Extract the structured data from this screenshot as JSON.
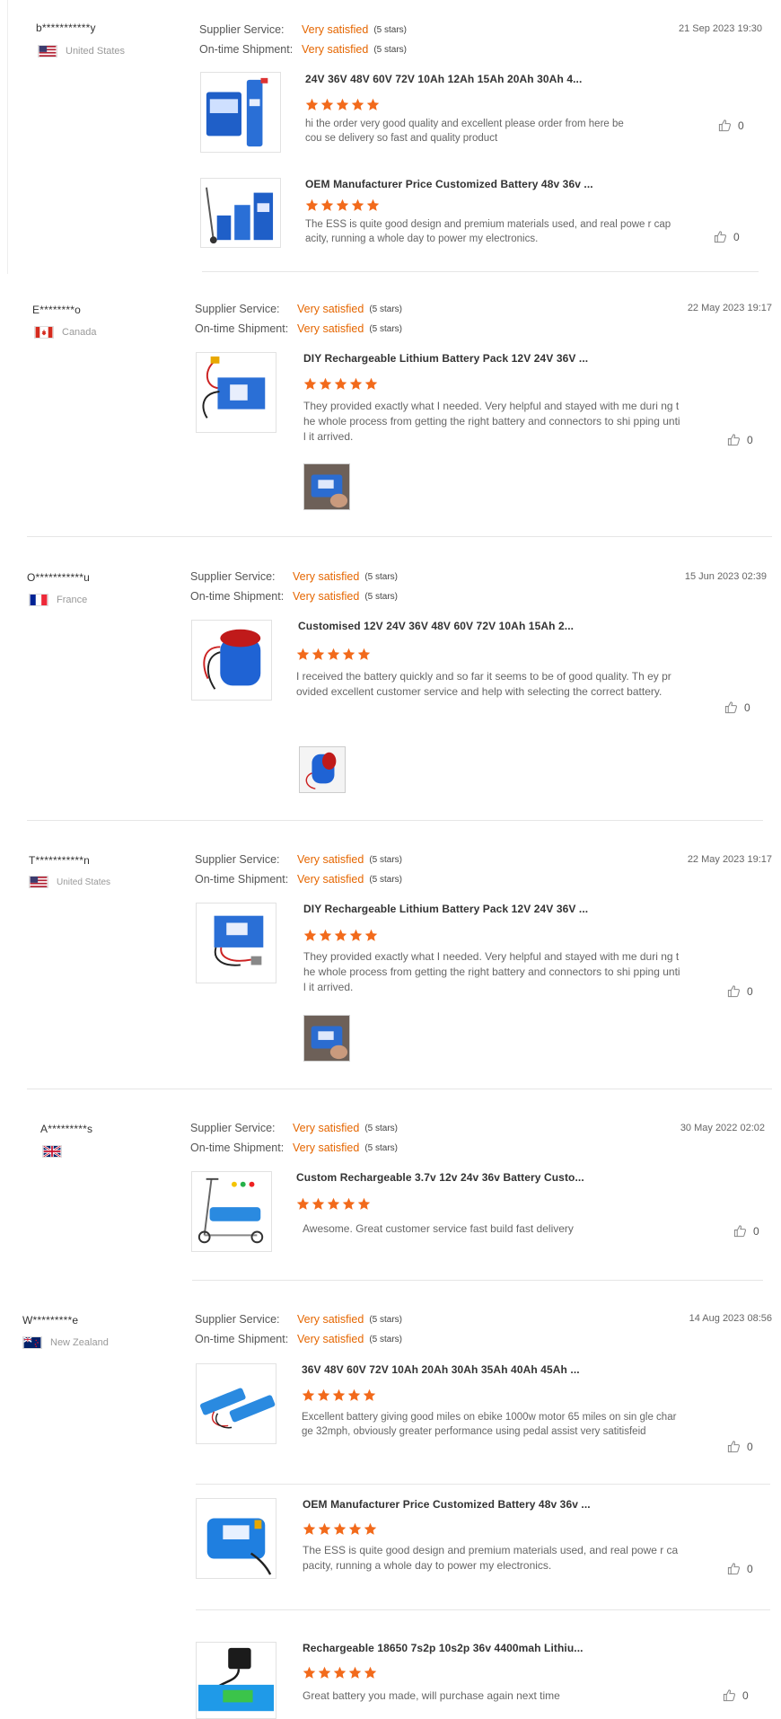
{
  "labels": {
    "supplier_service": "Supplier Service:",
    "on_time_shipment": "On-time Shipment:",
    "very_satisfied": "Very satisfied",
    "five_stars": "(5 stars)"
  },
  "colors": {
    "accent_orange": "#e56600",
    "star_orange": "#f26a1b",
    "divider": "#e6e6e6"
  },
  "reviews": [
    {
      "user": "b***********y",
      "country": "United States",
      "flag": "us-flag-icon",
      "date": "21 Sep 2023 19:30",
      "products": [
        {
          "title": "24V 36V 48V 60V 72V 10Ah 12Ah 15Ah 20Ah 30Ah 4...",
          "comment": "hi the order very good quality and excellent  please order from here becou se delivery so fast and quality product",
          "likes": "0",
          "rating": 5
        },
        {
          "title": "OEM Manufacturer Price Customized Battery 48v 36v ...",
          "comment": "The ESS is quite good design and premium materials used, and real powe r capacity, running a whole day to power my electronics.",
          "likes": "0",
          "rating": 5
        }
      ]
    },
    {
      "user": "E********o",
      "country": "Canada",
      "flag": "canada-flag-icon",
      "date": "22 May 2023 19:17",
      "products": [
        {
          "title": "DIY Rechargeable Lithium Battery Pack 12V 24V 36V ...",
          "comment": "They provided exactly what I needed. Very helpful and stayed with me duri ng the whole process from getting the right battery and connectors to shi pping until it arrived.",
          "likes": "0",
          "rating": 5
        }
      ]
    },
    {
      "user": "O***********u",
      "country": "France",
      "flag": "france-flag-icon",
      "date": "15 Jun 2023 02:39",
      "products": [
        {
          "title": "Customised 12V 24V 36V 48V 60V 72V 10Ah 15Ah 2...",
          "comment": "I received the battery quickly and so far it seems to be of good quality. Th ey provided excellent customer service and help with selecting the correct battery.",
          "likes": "0",
          "rating": 5
        }
      ]
    },
    {
      "user": "T***********n",
      "country": "United States",
      "flag": "us-flag-icon",
      "date": "22 May 2023 19:17",
      "products": [
        {
          "title": "DIY Rechargeable Lithium Battery Pack 12V 24V 36V ...",
          "comment": "They provided exactly what I needed. Very helpful and stayed with me duri ng the whole process from getting the right battery and connectors to shi pping until it arrived.",
          "likes": "0",
          "rating": 5
        }
      ]
    },
    {
      "user": "A*********s",
      "country": "",
      "flag": "uk-flag-icon",
      "date": "30 May 2022 02:02",
      "products": [
        {
          "title": "Custom Rechargeable 3.7v 12v 24v 36v Battery Custo...",
          "comment": "Awesome. Great customer service fast build fast delivery",
          "likes": "0",
          "rating": 5
        }
      ]
    },
    {
      "user": "W*********e",
      "country": "New Zealand",
      "flag": "new-zealand-flag-icon",
      "date": "14 Aug 2023 08:56",
      "products": [
        {
          "title": "36V 48V 60V 72V 10Ah 20Ah 30Ah 35Ah 40Ah 45Ah ...",
          "comment": "Excellent battery giving good miles on ebike 1000w motor 65 miles on sin gle charge 32mph, obviously greater performance using pedal assist very satitisfeid",
          "likes": "0",
          "rating": 5
        },
        {
          "title": "OEM Manufacturer Price Customized Battery 48v 36v ...",
          "comment": "The ESS is quite good design and premium materials used, and real powe r capacity, running a whole day to power my electronics.",
          "likes": "0",
          "rating": 5
        },
        {
          "title": "Rechargeable 18650 7s2p 10s2p 36v 4400mah Lithiu...",
          "comment": "Great battery you made, will purchase again next time",
          "likes": "0",
          "rating": 5
        }
      ]
    }
  ]
}
